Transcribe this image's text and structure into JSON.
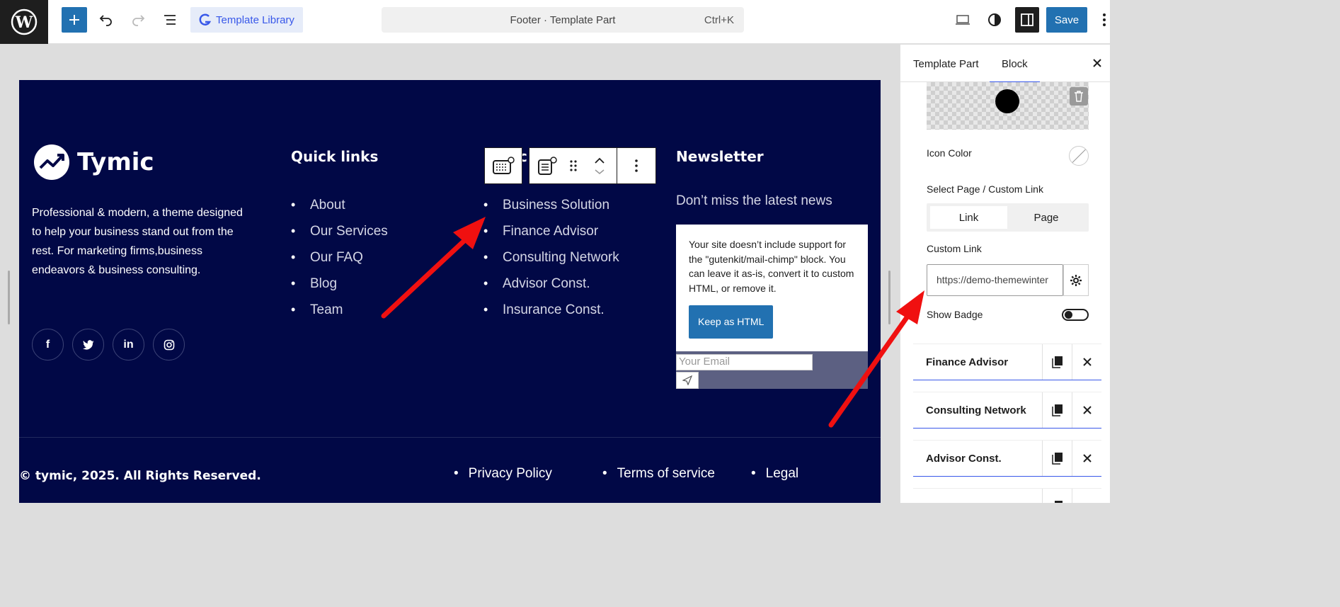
{
  "topbar": {
    "template_library_label": "Template Library",
    "document_title": "Footer · Template Part",
    "shortcut": "Ctrl+K",
    "save_label": "Save"
  },
  "footer": {
    "brand_name": "Tymic",
    "brand_description": "Professional & modern, a theme designed to help your business stand out from the rest. For marketing firms,business endeavors & business consulting.",
    "socials": [
      "facebook",
      "twitter",
      "linkedin",
      "instagram"
    ],
    "quick_links_title": "Quick links",
    "quick_links": [
      "About",
      "Our Services",
      "Our FAQ",
      "Blog",
      "Team"
    ],
    "services_title_partial": "c",
    "services": [
      "Business Solution",
      "Finance Advisor",
      "Consulting Network",
      "Advisor Const.",
      "Insurance Const."
    ],
    "newsletter_title": "Newsletter",
    "newsletter_text": "Don’t miss the latest news",
    "warning_text": "Your site doesn’t include support for the \"gutenkit/mail-chimp\" block. You can leave it as-is, convert it to custom HTML, or remove it.",
    "keep_html_label": "Keep as HTML",
    "email_placeholder": "Your Email",
    "copyright": "© tymic, 2025. All Rights Reserved.",
    "bottom_links": [
      "Privacy Policy",
      "Terms of service",
      "Legal"
    ]
  },
  "sidebar": {
    "tabs": [
      "Template Part",
      "Block"
    ],
    "active_tab": "Block",
    "icon_color_label": "Icon Color",
    "select_page_label": "Select Page / Custom Link",
    "segment_options": [
      "Link",
      "Page"
    ],
    "segment_selected": "Link",
    "custom_link_label": "Custom Link",
    "custom_link_value": "https://demo-themewinter",
    "show_badge_label": "Show Badge",
    "show_badge_on": false,
    "items": [
      "Finance Advisor",
      "Consulting Network",
      "Advisor Const."
    ]
  },
  "colors": {
    "accent": "#2271b1",
    "footer_bg": "#010846",
    "wp_bar": "#1e1e1e"
  }
}
